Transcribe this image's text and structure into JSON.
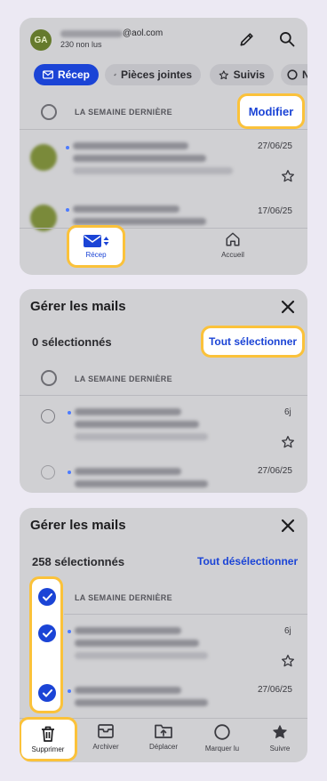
{
  "panel1": {
    "avatar_initials": "GA",
    "account_suffix": "@aol.com",
    "unread_count": "230 non lus",
    "filters": [
      {
        "label": "Récep",
        "icon": "mail-icon"
      },
      {
        "label": "Pièces jointes",
        "icon": "paperclip-icon"
      },
      {
        "label": "Suivis",
        "icon": "star-icon"
      },
      {
        "label": "N",
        "icon": "circle-icon"
      }
    ],
    "section": "LA SEMAINE DERNIÈRE",
    "modify": "Modifier",
    "dates": [
      "27/06/25",
      "17/06/25"
    ],
    "tabs": [
      {
        "label": "Récep",
        "icon": "mail-icon"
      },
      {
        "label": "Accueil",
        "icon": "home-icon"
      }
    ]
  },
  "panel2": {
    "title": "Gérer les mails",
    "count": "0 sélectionnés",
    "select_all": "Tout sélectionner",
    "section": "LA SEMAINE DERNIÈRE",
    "dates": [
      "6j",
      "27/06/25"
    ]
  },
  "panel3": {
    "title": "Gérer les mails",
    "count": "258 sélectionnés",
    "deselect_all": "Tout désélectionner",
    "section": "LA SEMAINE DERNIÈRE",
    "dates": [
      "6j",
      "27/06/25"
    ],
    "actions": [
      {
        "label": "Supprimer",
        "icon": "trash-icon"
      },
      {
        "label": "Archiver",
        "icon": "archive-icon"
      },
      {
        "label": "Déplacer",
        "icon": "move-folder-icon"
      },
      {
        "label": "Marquer lu",
        "icon": "circle-icon"
      },
      {
        "label": "Suivre",
        "icon": "star-icon"
      }
    ]
  },
  "colors": {
    "accent": "#1b44d6",
    "highlight": "#fbc23a",
    "panel": "#d0d0d3",
    "background": "#ece9f3"
  }
}
